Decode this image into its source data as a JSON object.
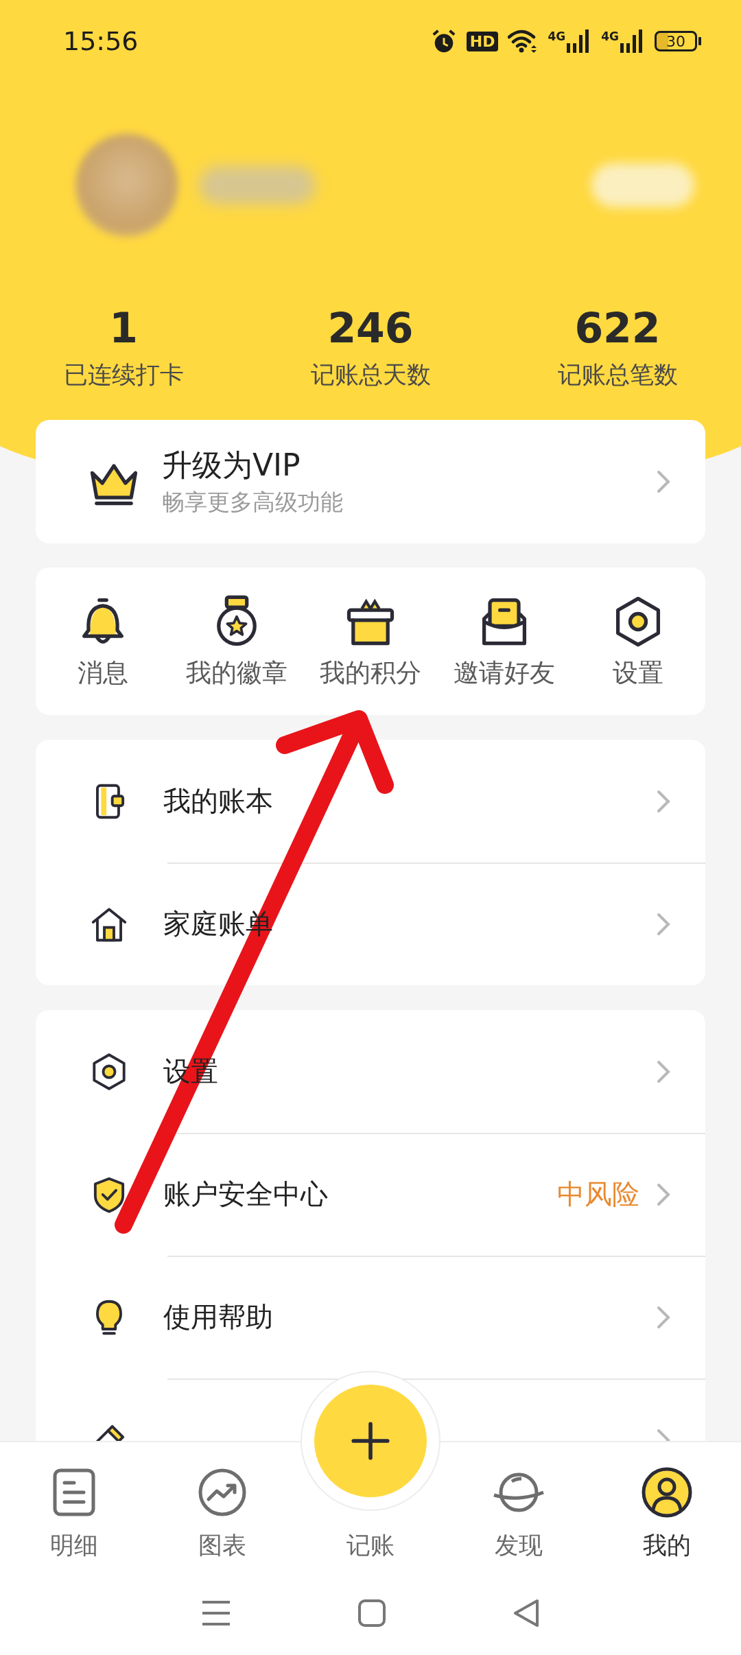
{
  "status_bar": {
    "time": "15:56",
    "hd_badge": "HD",
    "networks": [
      {
        "label": "4G"
      },
      {
        "label": "4G"
      }
    ],
    "battery": "30"
  },
  "stats": [
    {
      "value": "1",
      "label": "已连续打卡"
    },
    {
      "value": "246",
      "label": "记账总天数"
    },
    {
      "value": "622",
      "label": "记账总笔数"
    }
  ],
  "vip_card": {
    "title": "升级为VIP",
    "subtitle": "畅享更多高级功能"
  },
  "shortcuts": [
    {
      "label": "消息",
      "kind": "bell"
    },
    {
      "label": "我的徽章",
      "kind": "medal"
    },
    {
      "label": "我的积分",
      "kind": "gift"
    },
    {
      "label": "邀请好友",
      "kind": "envelope"
    },
    {
      "label": "设置",
      "kind": "hexagon"
    }
  ],
  "menu_groups": [
    [
      {
        "label": "我的账本",
        "kind": "book"
      },
      {
        "label": "家庭账单",
        "kind": "house"
      }
    ],
    [
      {
        "label": "设置",
        "kind": "hexagon"
      },
      {
        "label": "账户安全中心",
        "kind": "shield",
        "status": "中风险"
      },
      {
        "label": "使用帮助",
        "kind": "bulb"
      },
      {
        "kind": "pencil"
      }
    ]
  ],
  "bottom_nav": [
    {
      "label": "明细",
      "kind": "list",
      "selected": false
    },
    {
      "label": "图表",
      "kind": "chart",
      "selected": false
    },
    {
      "label": "记账",
      "kind": "add",
      "selected": false
    },
    {
      "label": "发现",
      "kind": "planet",
      "selected": false
    },
    {
      "label": "我的",
      "kind": "person",
      "selected": true
    }
  ]
}
